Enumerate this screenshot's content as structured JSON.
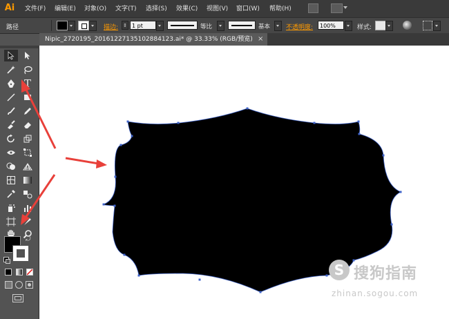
{
  "app": {
    "logo": "Ai"
  },
  "menu": {
    "items": [
      "文件(F)",
      "编辑(E)",
      "对象(O)",
      "文字(T)",
      "选择(S)",
      "效果(C)",
      "视图(V)",
      "窗口(W)",
      "帮助(H)"
    ]
  },
  "control_bar": {
    "selection_type": "路径",
    "stroke_label": "描边:",
    "stroke_weight": "1 pt",
    "variable_width_label": "等比",
    "brush_label": "基本",
    "opacity_label": "不透明度:",
    "opacity_value": "100%",
    "style_label": "样式:"
  },
  "document": {
    "tab_title": "Nipic_2720195_20161227135102884123.ai* @ 33.33% (RGB/预览)",
    "close_glyph": "×"
  },
  "tools": {
    "type_tool_glyph": "T"
  },
  "watermark": {
    "glyph": "S",
    "brand": "搜狗指南",
    "url": "zhinan.sogou.com"
  },
  "colors": {
    "accent": "#ff9a00",
    "arrow": "#e8403a",
    "path_anchor": "#3f63c8",
    "shape_fill": "#000000"
  }
}
